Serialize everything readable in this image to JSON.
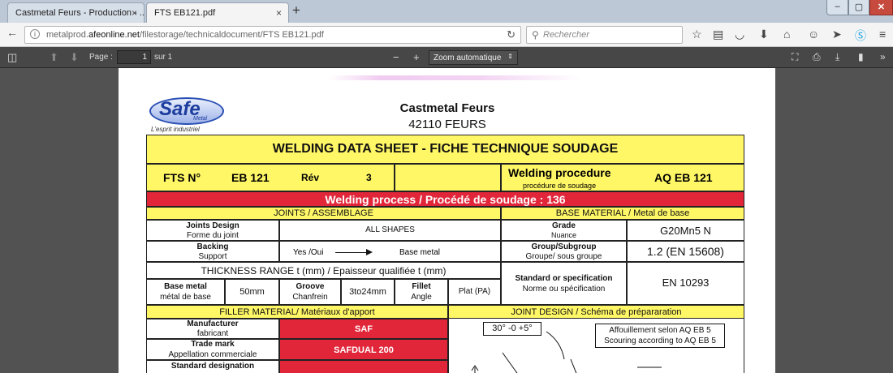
{
  "tabs": [
    {
      "title": "Castmetal Feurs - Production - ...",
      "close": "×"
    },
    {
      "title": "FTS EB121.pdf",
      "close": "×"
    }
  ],
  "new_tab": "+",
  "window": {
    "minimize": "‒",
    "maximize": "▢",
    "close": "✕"
  },
  "nav": {
    "back": "←",
    "info": "i",
    "url_prefix": "metalprod.",
    "url_domain": "afeonline.net",
    "url_path": "/filestorage/technicaldocument/FTS EB121.pdf",
    "reload": "↻",
    "search_placeholder": "Rechercher"
  },
  "toolbar_icons": [
    "star-icon",
    "reading-list-icon",
    "pocket-icon",
    "download-icon",
    "home-icon",
    "chat-icon",
    "send-icon",
    "skype-icon",
    "menu-icon"
  ],
  "pdf": {
    "sidebar_toggle": "◫",
    "prev": "⬆",
    "next": "⬇",
    "page_label": "Page :",
    "page_value": "1",
    "page_of": "sur 1",
    "zoom_out": "−",
    "zoom_in": "+",
    "zoom_value": "Zoom automatique",
    "zoom_arrow": "⇕"
  },
  "doc": {
    "logo": {
      "brand": "Safe",
      "sub": "Metal",
      "tagline": "L'esprit industriel"
    },
    "company": "Castmetal Feurs",
    "city": "42110 FEURS",
    "sheet_title": "WELDING DATA SHEET  -  FICHE TECHNIQUE SOUDAGE",
    "fts_label": "FTS N°",
    "fts_value": "EB 121",
    "rev_label": "Rév",
    "rev_value": "3",
    "wp_label": "Welding procedure",
    "wp_sub": "procédure de soudage",
    "wp_value": "AQ EB 121",
    "process": "Welding process / Procédé de soudage : 136",
    "joints_header": "JOINTS / ASSEMBLAGE",
    "base_header": "BASE MATERIAL / Metal de base",
    "joints_design": "Joints Design",
    "joints_design_fr": "Forme du joint",
    "joints_design_val": "ALL SHAPES",
    "backing": "Backing",
    "backing_fr": "Support",
    "backing_yes": "Yes /Oui",
    "backing_val": "Base metal",
    "grade": "Grade",
    "grade_fr": "Nuance",
    "grade_val": "G20Mn5 N",
    "group": "Group/Subgroup",
    "group_fr": "Groupe/ sous groupe",
    "group_val": "1.2 (EN 15608)",
    "thickness": "THICKNESS RANGE t (mm) / Epaisseur qualifiée t (mm)",
    "std_spec": "Standard or specification",
    "std_spec_fr": "Norme ou spécification",
    "std_spec_val": "EN 10293",
    "bm": "Base metal",
    "bm_fr": "métal de base",
    "bm_val": "50mm",
    "groove": "Groove",
    "groove_fr": "Chanfrein",
    "groove_val": "3to24mm",
    "fillet": "Fillet",
    "fillet_fr": "Angle",
    "fillet_val": "Plat (PA)",
    "filler_header": "FILLER MATERIAL/ Matériaux d'apport",
    "jd_header": "JOINT DESIGN / Schéma de prépararation",
    "manufacturer": "Manufacturer",
    "manufacturer_fr": "fabricant",
    "manufacturer_val": "SAF",
    "trademark": "Trade mark",
    "trademark_fr": "Appellation commerciale",
    "trademark_val": "SAFDUAL 200",
    "std_designation": "Standard designation",
    "angle_label": "30° -0 +5°",
    "aff_line1": "Affouillement selon AQ EB 5",
    "aff_line2": "Scouring according to AQ EB 5"
  },
  "colors": {
    "yellow": "#fff766",
    "red": "#e1263a",
    "toolbar": "#474747",
    "viewer": "#525252"
  }
}
